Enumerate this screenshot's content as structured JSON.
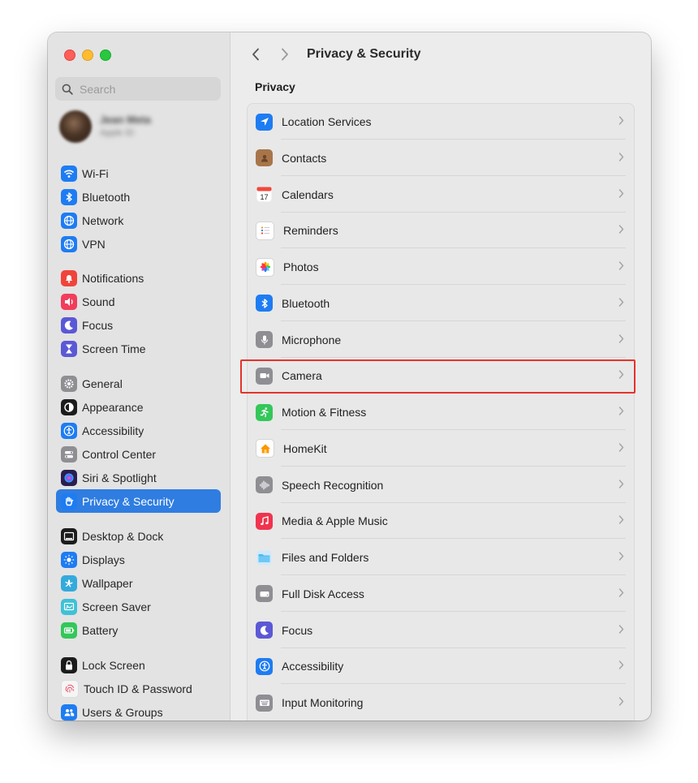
{
  "window": {
    "title": "Privacy & Security"
  },
  "search": {
    "placeholder": "Search"
  },
  "profile": {
    "name": "Jean Meta",
    "subtitle": "Apple ID"
  },
  "sidebar": {
    "items": [
      {
        "label": "Wi-Fi",
        "icon": "wifi-icon",
        "color": "#1e7cf2"
      },
      {
        "label": "Bluetooth",
        "icon": "bluetooth-icon",
        "color": "#1e7cf2"
      },
      {
        "label": "Network",
        "icon": "globe-icon",
        "color": "#1e7cf2"
      },
      {
        "label": "VPN",
        "icon": "vpn-globe-icon",
        "color": "#1e7cf2"
      },
      {
        "label": "Notifications",
        "icon": "bell-icon",
        "color": "#f0443a"
      },
      {
        "label": "Sound",
        "icon": "speaker-icon",
        "color": "#f03e5c"
      },
      {
        "label": "Focus",
        "icon": "moon-icon",
        "color": "#5b58d6"
      },
      {
        "label": "Screen Time",
        "icon": "hourglass-icon",
        "color": "#5b58d6"
      },
      {
        "label": "General",
        "icon": "gear-icon",
        "color": "#8e8e93"
      },
      {
        "label": "Appearance",
        "icon": "appearance-icon",
        "color": "#1c1c1e"
      },
      {
        "label": "Accessibility",
        "icon": "accessibility-icon",
        "color": "#1e7cf2"
      },
      {
        "label": "Control Center",
        "icon": "toggles-icon",
        "color": "#8e8e93"
      },
      {
        "label": "Siri & Spotlight",
        "icon": "siri-icon",
        "color": "#2b1e4f"
      },
      {
        "label": "Privacy & Security",
        "icon": "hand-icon",
        "color": "#1e7cf2"
      },
      {
        "label": "Desktop & Dock",
        "icon": "dock-icon",
        "color": "#1c1c1e"
      },
      {
        "label": "Displays",
        "icon": "sun-icon",
        "color": "#1e7cf2"
      },
      {
        "label": "Wallpaper",
        "icon": "wallpaper-icon",
        "color": "#34aadc"
      },
      {
        "label": "Screen Saver",
        "icon": "screensaver-icon",
        "color": "#3fc1d6"
      },
      {
        "label": "Battery",
        "icon": "battery-icon",
        "color": "#34c759"
      },
      {
        "label": "Lock Screen",
        "icon": "lock-icon",
        "color": "#1c1c1e"
      },
      {
        "label": "Touch ID & Password",
        "icon": "fingerprint-icon",
        "color": "#f5f5f5"
      },
      {
        "label": "Users & Groups",
        "icon": "users-icon",
        "color": "#1e7cf2"
      }
    ],
    "active_index": 13
  },
  "main": {
    "section_title": "Privacy",
    "rows": [
      {
        "label": "Location Services",
        "icon": "location-arrow-icon",
        "color": "#1e7cf2"
      },
      {
        "label": "Contacts",
        "icon": "contacts-icon",
        "color": "#a8754a"
      },
      {
        "label": "Calendars",
        "icon": "calendar-icon",
        "color": "#ffffff",
        "badge": "17"
      },
      {
        "label": "Reminders",
        "icon": "reminders-icon",
        "color": "#ffffff"
      },
      {
        "label": "Photos",
        "icon": "photos-icon",
        "color": "#ffffff"
      },
      {
        "label": "Bluetooth",
        "icon": "bluetooth-icon",
        "color": "#1e7cf2"
      },
      {
        "label": "Microphone",
        "icon": "microphone-icon",
        "color": "#8e8e93"
      },
      {
        "label": "Camera",
        "icon": "camera-icon",
        "color": "#8e8e93"
      },
      {
        "label": "Motion & Fitness",
        "icon": "running-icon",
        "color": "#34c759"
      },
      {
        "label": "HomeKit",
        "icon": "home-icon",
        "color": "#ffffff"
      },
      {
        "label": "Speech Recognition",
        "icon": "waveform-icon",
        "color": "#8e8e93"
      },
      {
        "label": "Media & Apple Music",
        "icon": "music-icon",
        "color": "#f0344e"
      },
      {
        "label": "Files and Folders",
        "icon": "folder-icon",
        "color": "#5ac8fa"
      },
      {
        "label": "Full Disk Access",
        "icon": "disk-icon",
        "color": "#8e8e93"
      },
      {
        "label": "Focus",
        "icon": "moon-icon",
        "color": "#5b58d6"
      },
      {
        "label": "Accessibility",
        "icon": "accessibility-icon",
        "color": "#1e7cf2"
      },
      {
        "label": "Input Monitoring",
        "icon": "keyboard-icon",
        "color": "#8e8e93"
      }
    ],
    "highlighted_row": "Camera",
    "highlight_color": "#e5332a"
  }
}
